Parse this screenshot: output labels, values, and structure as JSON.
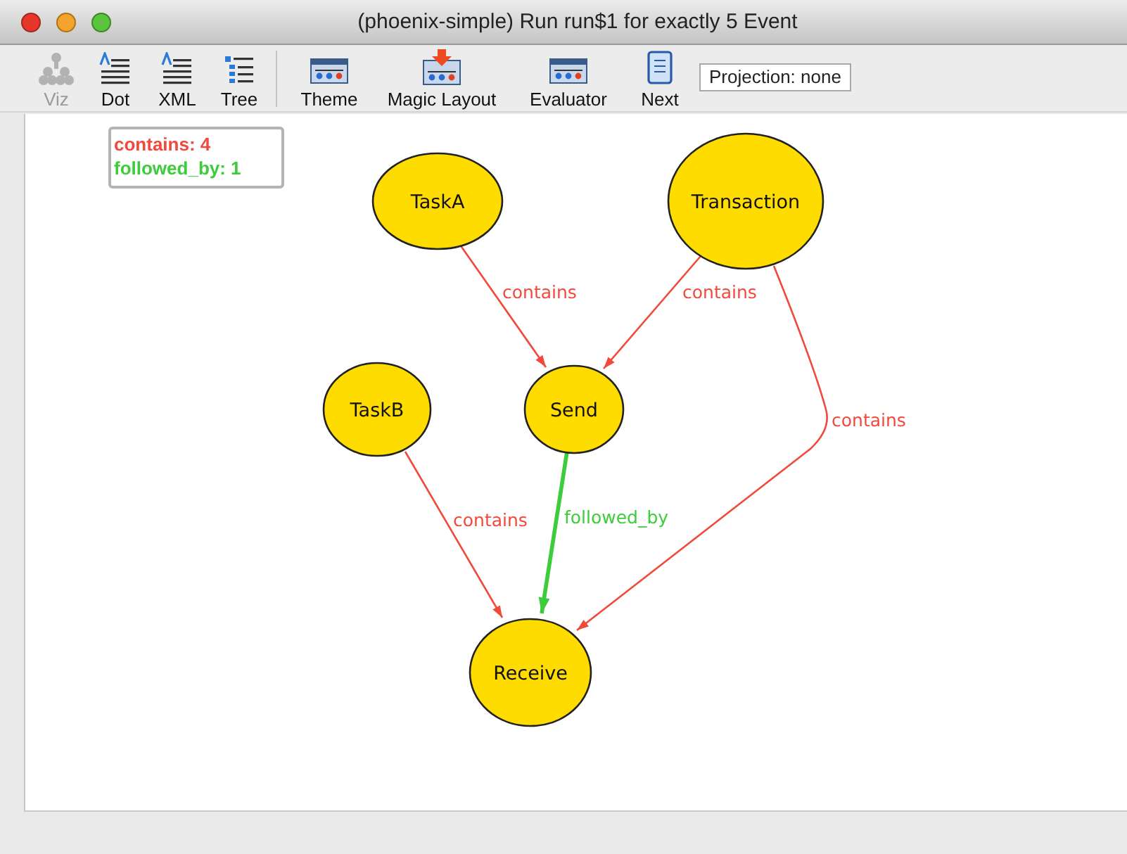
{
  "window": {
    "title": "(phoenix-simple) Run run$1 for exactly 5 Event"
  },
  "toolbar": [
    {
      "label": "Viz",
      "kind": "viz",
      "disabled": true
    },
    {
      "label": "Dot",
      "kind": "text",
      "disabled": false
    },
    {
      "label": "XML",
      "kind": "text",
      "disabled": false
    },
    {
      "label": "Tree",
      "kind": "tree",
      "disabled": false
    },
    {
      "label": "Theme",
      "kind": "theme",
      "disabled": false
    },
    {
      "label": "Magic Layout",
      "kind": "magic",
      "disabled": false
    },
    {
      "label": "Evaluator",
      "kind": "theme",
      "disabled": false
    },
    {
      "label": "Next",
      "kind": "next",
      "disabled": false
    }
  ],
  "projection": {
    "label": "Projection: none"
  },
  "legend": [
    {
      "text": "contains: 4",
      "color": "#f04a3c"
    },
    {
      "text": "followed_by: 1",
      "color": "#3ccc3c"
    }
  ],
  "graph": {
    "nodes": [
      {
        "name": "TaskA"
      },
      {
        "name": "Transaction"
      },
      {
        "name": "TaskB"
      },
      {
        "name": "Send"
      },
      {
        "name": "Receive"
      }
    ],
    "edges": [
      {
        "label": "contains",
        "color": "#f04a3c",
        "kind": "thin"
      },
      {
        "label": "contains",
        "color": "#f04a3c",
        "kind": "thin"
      },
      {
        "label": "contains",
        "color": "#f04a3c",
        "kind": "thin"
      },
      {
        "label": "followed_by",
        "color": "#3ccc3c",
        "kind": "thick"
      },
      {
        "label": "contains",
        "color": "#f04a3c",
        "kind": "thin"
      }
    ]
  }
}
